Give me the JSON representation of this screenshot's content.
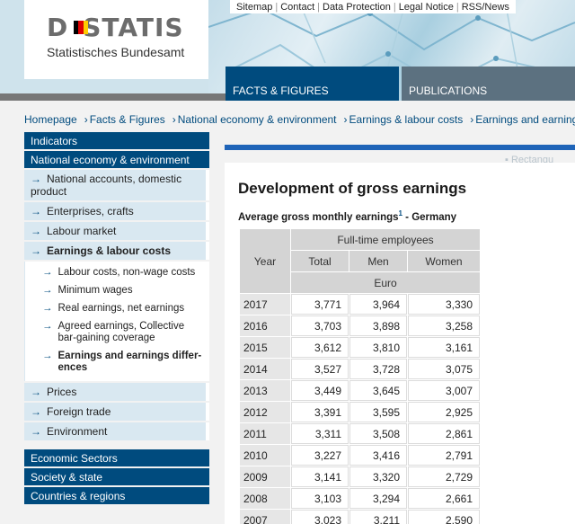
{
  "logo": {
    "title": "DSTATIS",
    "title_first": "D",
    "title_rest": "STATIS",
    "subtitle": "Statistisches Bundesamt",
    "flag_colors": [
      "#000000",
      "#dd0000",
      "#ffcc00"
    ]
  },
  "service_links": [
    "Sitemap",
    "Contact",
    "Data Protection",
    "Legal Notice",
    "RSS/News"
  ],
  "topnav": {
    "facts": "FACTS & FIGURES",
    "publications": "PUBLICATIONS"
  },
  "breadcrumb": [
    "Homepage",
    "Facts & Figures",
    "National economy & environment",
    "Earnings & labour costs",
    "Earnings and earnings di"
  ],
  "sidebar": {
    "indicators": "Indicators",
    "national": "National economy & environment",
    "items": [
      "National accounts, domestic product",
      "Enterprises, crafts",
      "Labour market",
      "Earnings & labour costs"
    ],
    "subitems": [
      "Labour costs, non-wage costs",
      "Minimum wages",
      "Real earnings, net earnings",
      "Agreed earnings, Collective bar-gaining coverage",
      "Earnings and earnings differ-ences"
    ],
    "more_items": [
      "Prices",
      "Foreign trade",
      "Environment"
    ],
    "sections": [
      "Economic Sectors",
      "Society & state",
      "Countries & regions"
    ]
  },
  "ghost_text": "Rectangu",
  "main": {
    "title": "Development of gross earnings",
    "caption_pre": "Average gross monthly earnings",
    "caption_sup": "1",
    "caption_post": " - Germany"
  },
  "table": {
    "year_header": "Year",
    "group_header": "Full-time employees",
    "columns": [
      "Total",
      "Men",
      "Women"
    ],
    "unit": "Euro",
    "rows": [
      [
        "2017",
        "3,771",
        "3,964",
        "3,330"
      ],
      [
        "2016",
        "3,703",
        "3,898",
        "3,258"
      ],
      [
        "2015",
        "3,612",
        "3,810",
        "3,161"
      ],
      [
        "2014",
        "3,527",
        "3,728",
        "3,075"
      ],
      [
        "2013",
        "3,449",
        "3,645",
        "3,007"
      ],
      [
        "2012",
        "3,391",
        "3,595",
        "2,925"
      ],
      [
        "2011",
        "3,311",
        "3,508",
        "2,861"
      ],
      [
        "2010",
        "3,227",
        "3,416",
        "2,791"
      ],
      [
        "2009",
        "3,141",
        "3,320",
        "2,729"
      ],
      [
        "2008",
        "3,103",
        "3,294",
        "2,661"
      ],
      [
        "2007",
        "3,023",
        "3,211",
        "2,590"
      ]
    ]
  }
}
